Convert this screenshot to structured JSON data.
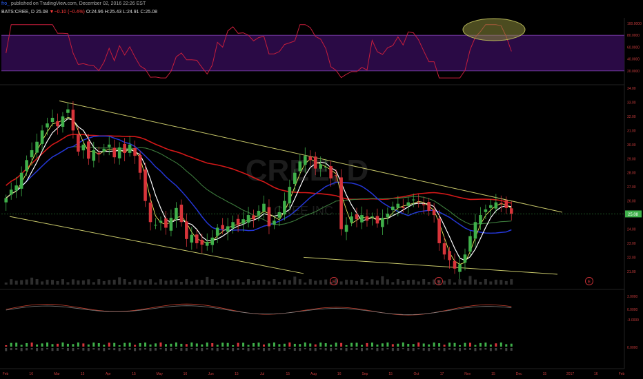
{
  "header": {
    "author": "fro_",
    "published": "published on TradingView.com, December 02, 2016 22:26 EST",
    "symbol": "BATS:CREE, D",
    "last": "25.08",
    "change_arrow": "▼",
    "change": "−0.10 (−0.4%)",
    "open": "O:24.96",
    "high": "H:25.43",
    "low": "L:24.91",
    "close": "C:25.08"
  },
  "watermark": {
    "ticker": "CREE, D",
    "name": "CREE INC"
  },
  "colors": {
    "background": "#000000",
    "band_fill": "#2a0a45",
    "band_line": "#7a3fa8",
    "osc_line": "#c81e3c",
    "up_candle": "#3fb04a",
    "down_candle": "#d8343a",
    "ma_red": "#d41818",
    "ma_blue": "#2436d6",
    "ma_green": "#3c7a3c",
    "ma_white": "#ffffff",
    "ma_yellow": "#e8e860",
    "trendline": "#c8c86a",
    "price_tag": "#3fb04a",
    "axis_text": "#c83c3c",
    "highlight": "#8a8a3a"
  },
  "chart_data": {
    "type": "candlestick",
    "indicator_axis_labels": [
      "100.0000",
      "80.0000",
      "60.0000",
      "40.0000",
      "20.0000"
    ],
    "price_axis_labels": [
      "34.00",
      "33.00",
      "32.00",
      "31.00",
      "30.00",
      "29.00",
      "28.00",
      "27.00",
      "26.00",
      "25.00",
      "24.00",
      "23.00",
      "22.00",
      "21.00"
    ],
    "price_ylim": [
      20.7,
      34.0
    ],
    "last_price_label": "25.08",
    "lower_axis_labels": [
      "3.0000",
      "0.0000",
      "-3.0000",
      "0.0000"
    ],
    "x_axis_labels": [
      "Feb",
      "16",
      "Mar",
      "15",
      "Apr",
      "15",
      "May",
      "16",
      "Jun",
      "15",
      "Jul",
      "15",
      "Aug",
      "16",
      "Sep",
      "15",
      "Oct",
      "17",
      "Nov",
      "15",
      "Dec",
      "15",
      "2017",
      "16",
      "Feb"
    ],
    "earnings_marker": "E",
    "close_series": [
      26.2,
      26.8,
      27.1,
      28.0,
      28.9,
      29.6,
      30.2,
      31.0,
      31.5,
      31.9,
      31.3,
      32.0,
      32.5,
      31.0,
      29.5,
      30.0,
      29.0,
      29.6,
      29.3,
      29.7,
      30.0,
      29.1,
      29.8,
      29.4,
      30.0,
      29.2,
      28.0,
      26.0,
      24.5,
      24.3,
      24.6,
      24.1,
      24.8,
      25.5,
      24.5,
      23.3,
      23.6,
      23.0,
      22.9,
      23.1,
      23.4,
      24.1,
      24.0,
      24.2,
      24.5,
      24.3,
      24.7,
      25.0,
      24.7,
      25.3,
      25.8,
      24.2,
      24.6,
      25.2,
      26.0,
      27.0,
      28.0,
      28.8,
      29.2,
      28.9,
      28.3,
      28.6,
      28.4,
      27.6,
      27.8,
      24.0,
      24.3,
      24.9,
      24.7,
      25.0,
      24.6,
      24.9,
      24.4,
      24.8,
      25.1,
      25.6,
      25.8,
      25.5,
      25.9,
      26.1,
      25.9,
      25.7,
      25.3,
      25.0,
      23.0,
      22.2,
      21.8,
      21.2,
      21.5,
      22.2,
      23.5,
      24.5,
      25.0,
      25.4,
      25.7,
      25.9,
      25.8,
      25.5,
      25.1
    ]
  }
}
